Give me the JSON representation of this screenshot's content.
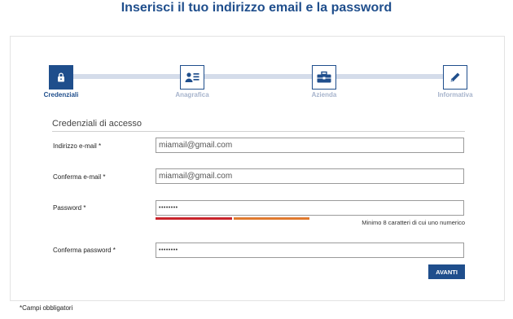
{
  "page_title": "Inserisci il tuo indirizzo email e la password",
  "colors": {
    "primary": "#1f4e8c",
    "strength_weak": "#c9242b",
    "strength_medium": "#e07a2f"
  },
  "steps": [
    {
      "label": "Credenziali",
      "icon": "lock-icon",
      "active": true
    },
    {
      "label": "Anagrafica",
      "icon": "id-card-icon",
      "active": false
    },
    {
      "label": "Azienda",
      "icon": "briefcase-icon",
      "active": false
    },
    {
      "label": "Informativa",
      "icon": "pencil-icon",
      "active": false
    }
  ],
  "form": {
    "section_title": "Credenziali di accesso",
    "email": {
      "label": "Indirizzo e-mail *",
      "value": "miamail@gmail.com"
    },
    "confirm_email": {
      "label": "Conferma e-mail *",
      "value": "miamail@gmail.com"
    },
    "password": {
      "label": "Password *",
      "value": "••••••••"
    },
    "password_hint": "Minimo 8 caratteri di cui uno numerico",
    "password_strength": "medium",
    "confirm_password": {
      "label": "Conferma password *",
      "value": "••••••••"
    },
    "submit_label": "AVANTI"
  },
  "required_note": "*Campi obbligatori"
}
